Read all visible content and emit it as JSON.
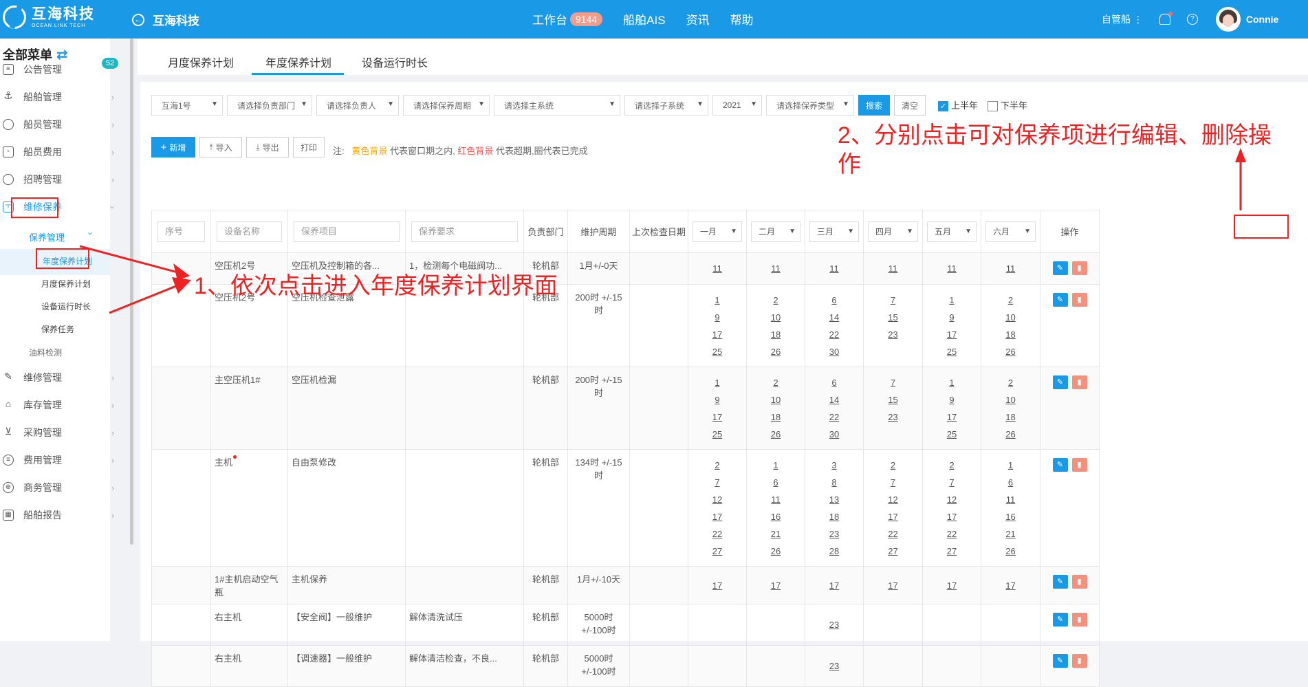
{
  "header": {
    "logo_cn": "互海科技",
    "logo_en": "OCEAN LINK TECH",
    "back_label": "互海科技",
    "nav": [
      {
        "label": "工作台",
        "badge": "9144"
      },
      {
        "label": "船舶AIS"
      },
      {
        "label": "资讯"
      },
      {
        "label": "帮助"
      }
    ],
    "ship_mode": "自管船",
    "username": "Connie"
  },
  "sidebar": {
    "title": "全部菜单",
    "items": [
      {
        "label": "公告管理",
        "badge": "52"
      },
      {
        "label": "船舶管理"
      },
      {
        "label": "船员管理"
      },
      {
        "label": "船员费用"
      },
      {
        "label": "招聘管理"
      },
      {
        "label": "维修保养"
      },
      {
        "label": "维修管理"
      },
      {
        "label": "库存管理"
      },
      {
        "label": "采购管理"
      },
      {
        "label": "费用管理"
      },
      {
        "label": "商务管理"
      },
      {
        "label": "船舶报告"
      }
    ],
    "sub_group": "保养管理",
    "sub_items": [
      "年度保养计划",
      "月度保养计划",
      "设备运行时长",
      "保养任务"
    ],
    "other_sub": "油料检测"
  },
  "tabs": [
    "月度保养计划",
    "年度保养计划",
    "设备运行时长"
  ],
  "filters": {
    "ship": "互海1号",
    "dept": "请选择负责部门",
    "owner": "请选择负责人",
    "cycle": "请选择保养周期",
    "main_system": "请选择主系统",
    "sub_system": "请选择子系统",
    "year": "2021",
    "type": "请选择保养类型",
    "search": "搜索",
    "clear": "清空",
    "first_half": "上半年",
    "second_half": "下半年"
  },
  "toolbar": {
    "add": "新增",
    "import": "导入",
    "export": "导出",
    "print": "打印",
    "note_prefix": "注:",
    "note_yellow": "黄色背景",
    "note_mid": "代表窗口期之内,",
    "note_red": "红色背景",
    "note_suffix": "代表超期,圈代表已完成"
  },
  "table": {
    "header_inputs": {
      "seq": "序号",
      "device": "设备名称",
      "item": "保养项目",
      "req": "保养要求"
    },
    "dept": "负责部门",
    "period": "维护周期",
    "last_check": "上次检查日期",
    "months": [
      "一月",
      "二月",
      "三月",
      "四月",
      "五月",
      "六月"
    ],
    "ops": "操作",
    "rows": [
      {
        "device": "空压机2号",
        "item": "空压机及控制箱的各...",
        "req": "1，检测每个电磁阀功...",
        "dept": "轮机部",
        "period": "1月+/-0天",
        "months": [
          [
            "11"
          ],
          [
            "11"
          ],
          [
            "11"
          ],
          [
            "11"
          ],
          [
            "11"
          ],
          [
            "11"
          ]
        ]
      },
      {
        "device": "空压机2号",
        "item": "空压机检查泄露",
        "req": "",
        "dept": "轮机部",
        "period": "200时 +/-15时",
        "months": [
          [
            "1",
            "9",
            "17",
            "25"
          ],
          [
            "2",
            "10",
            "18",
            "26"
          ],
          [
            "6",
            "14",
            "22",
            "30"
          ],
          [
            "7",
            "15",
            "23"
          ],
          [
            "1",
            "9",
            "17",
            "25"
          ],
          [
            "2",
            "10",
            "18",
            "26"
          ]
        ]
      },
      {
        "device": "主空压机1#",
        "item": "空压机检漏",
        "req": "",
        "dept": "轮机部",
        "period": "200时 +/-15时",
        "months": [
          [
            "1",
            "9",
            "17",
            "25"
          ],
          [
            "2",
            "10",
            "18",
            "26"
          ],
          [
            "6",
            "14",
            "22",
            "30"
          ],
          [
            "7",
            "15",
            "23"
          ],
          [
            "1",
            "9",
            "17",
            "25"
          ],
          [
            "2",
            "10",
            "18",
            "26"
          ]
        ]
      },
      {
        "device": "主机",
        "item": "自由泵修改",
        "req": "",
        "dept": "轮机部",
        "period": "134时 +/-15时",
        "months": [
          [
            "2",
            "7",
            "12",
            "17",
            "22",
            "27"
          ],
          [
            "1",
            "6",
            "11",
            "16",
            "21",
            "26"
          ],
          [
            "3",
            "8",
            "13",
            "18",
            "23",
            "28"
          ],
          [
            "2",
            "7",
            "12",
            "17",
            "22",
            "27"
          ],
          [
            "2",
            "7",
            "12",
            "17",
            "22",
            "27"
          ],
          [
            "1",
            "6",
            "11",
            "16",
            "21",
            "26"
          ]
        ]
      },
      {
        "device": "1#主机启动空气瓶",
        "item": "主机保养",
        "req": "",
        "dept": "轮机部",
        "period": "1月+/-10天",
        "months": [
          [
            "17"
          ],
          [
            "17"
          ],
          [
            "17"
          ],
          [
            "17"
          ],
          [
            "17"
          ],
          [
            "17"
          ]
        ]
      },
      {
        "device": "右主机",
        "item": "【安全阀】一般维护",
        "req": "解体清洗试压",
        "dept": "轮机部",
        "period": "5000时 +/-100时",
        "months": [
          [],
          [],
          [
            "23"
          ],
          [],
          [],
          []
        ]
      },
      {
        "device": "右主机",
        "item": "【调速器】一般维护",
        "req": "解体清洁检查，不良...",
        "dept": "轮机部",
        "period": "5000时 +/-100时",
        "months": [
          [],
          [],
          [
            "23"
          ],
          [],
          [],
          []
        ]
      }
    ]
  },
  "annotations": {
    "step1": "1、依次点击进入年度保养计划界面",
    "step2": "2、分别点击可对保养项进行编辑、删除操作"
  }
}
